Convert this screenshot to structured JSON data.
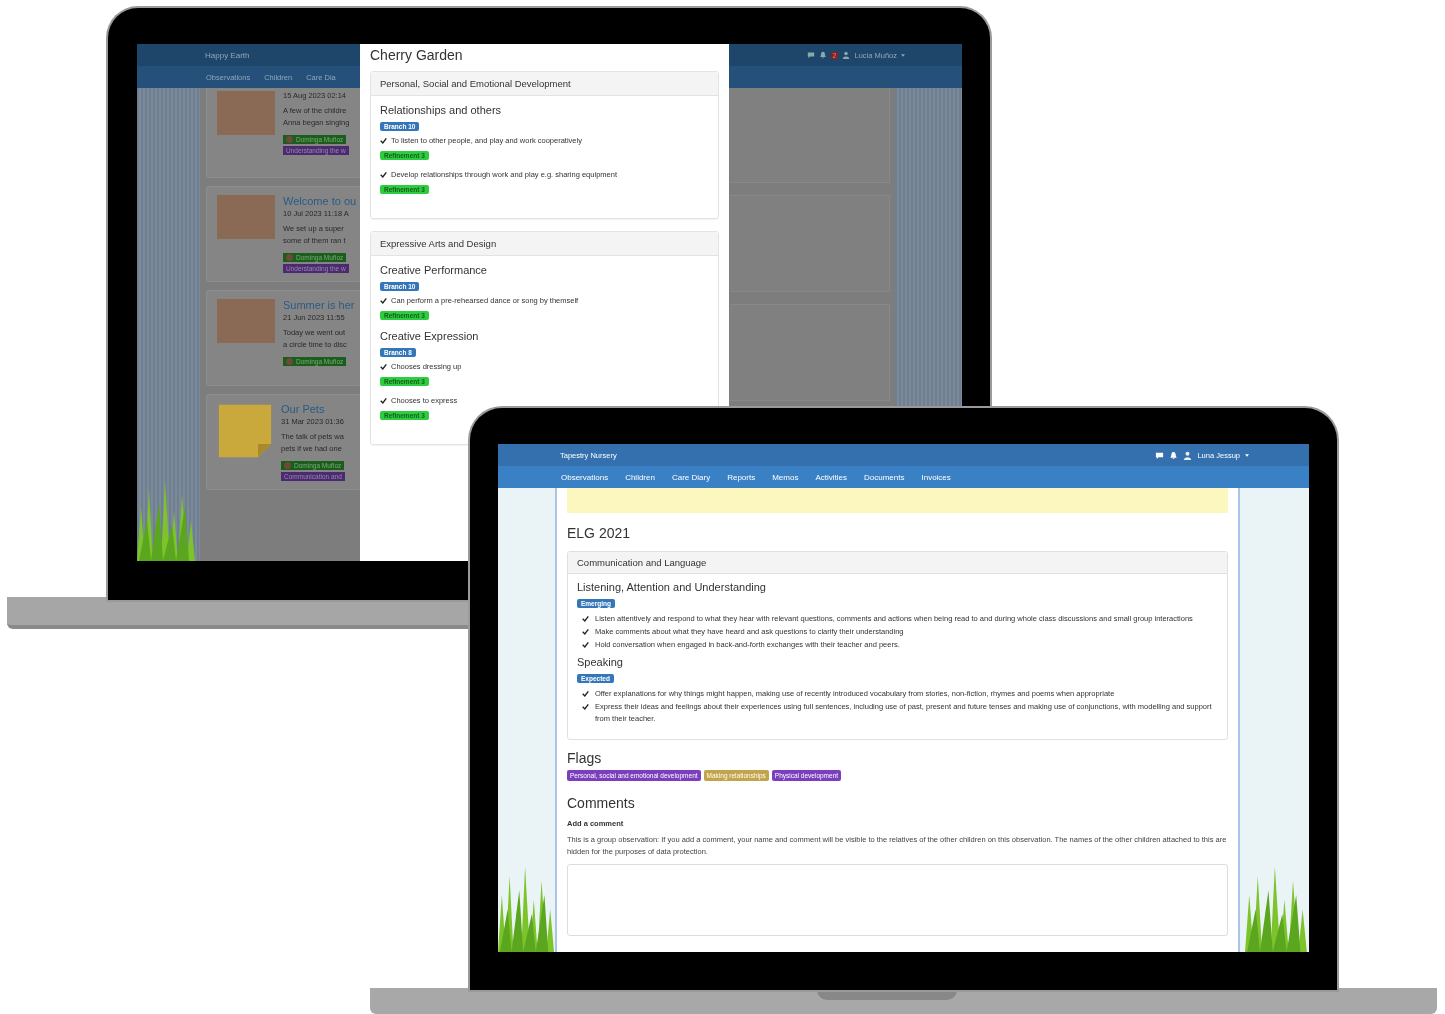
{
  "back_screen": {
    "header": {
      "brand": "Happy Earth",
      "nav": [
        "Observations",
        "Children",
        "Care Dia"
      ],
      "notification_count": "2",
      "user": "Lucia Muñoz"
    },
    "feed": [
      {
        "kind": "photo",
        "date": "15 Aug 2023 02:14",
        "text": [
          "A few of the childre",
          "Anna began singing"
        ],
        "person": "Dominga Muñoz",
        "tag": "Understanding the w"
      },
      {
        "kind": "photo",
        "title": "Welcome to ou",
        "date": "10 Jul 2023 11:18 A",
        "text": [
          "We set up a super",
          "some of them ran t"
        ],
        "person": "Dominga Muñoz",
        "tag": "Understanding the w"
      },
      {
        "kind": "photo",
        "title": "Summer is her",
        "date": "21 Jun 2023 11:55",
        "text": [
          "Today we went out",
          "a circle time to disc"
        ],
        "person": "Dominga Muñoz"
      },
      {
        "kind": "note",
        "title": "Our Pets",
        "date": "31 Mar 2023 01:36",
        "text": [
          "The talk of pets wa",
          "pets if we had one"
        ],
        "person": "Dominga Muñoz",
        "tag": "Communication and"
      }
    ],
    "modal": {
      "title": "Cherry Garden",
      "panels": [
        {
          "title": "Personal, Social and Emotional Development",
          "sections": [
            {
              "title": "Relationships and others",
              "branch": "Branch 10",
              "statements": [
                {
                  "text": "To listen to other people, and play and work cooperatively",
                  "refinement": "Refinement 3"
                },
                {
                  "text": "Develop relationships through work and play e.g. sharing equipment",
                  "refinement": "Refinement 3"
                }
              ]
            }
          ]
        },
        {
          "title": "Expressive Arts and Design",
          "sections": [
            {
              "title": "Creative Performance",
              "branch": "Branch 10",
              "statements": [
                {
                  "text": "Can perform a pre-rehearsed dance or song by themself",
                  "refinement": "Refinement 3"
                }
              ]
            },
            {
              "title": "Creative Expression",
              "branch": "Branch 8",
              "statements": [
                {
                  "text": "Chooses dressing up",
                  "refinement": "Refinement 3"
                },
                {
                  "text": "Chooses to express",
                  "refinement": "Refinement 3"
                }
              ]
            }
          ]
        }
      ]
    }
  },
  "front_screen": {
    "header": {
      "brand": "Tapestry Nursery",
      "user": "Luna Jessup",
      "nav": [
        "Observations",
        "Children",
        "Care Diary",
        "Reports",
        "Memos",
        "Activities",
        "Documents",
        "Invoices"
      ]
    },
    "heading": "ELG 2021",
    "panel": {
      "title": "Communication and Language",
      "sections": [
        {
          "title": "Listening, Attention and Understanding",
          "badge": "Emerging",
          "statements": [
            "Listen attentively and respond to what they hear with relevant questions, comments and actions when being read to and during whole class discussions and small group interactions",
            "Make comments about what they have heard and ask questions to clarify their understanding",
            "Hold conversation when engaged in back-and-forth exchanges with their teacher and peers."
          ]
        },
        {
          "title": "Speaking",
          "badge": "Expected",
          "statements": [
            "Offer explanations for why things might happen, making use of recently introduced vocabulary from stories, non-fiction, rhymes and poems when appropriate",
            "Express their ideas and feelings about their experiences using full sentences, including use of past, present and future tenses and making use of conjunctions, with modelling and support from their teacher."
          ]
        }
      ]
    },
    "flags_heading": "Flags",
    "flags": [
      {
        "label": "Personal, social and emotional development",
        "color": "#7b3fbe"
      },
      {
        "label": "Making relationships",
        "color": "#c2a44a"
      },
      {
        "label": "Physical development",
        "color": "#7b3fbe"
      }
    ],
    "comments_heading": "Comments",
    "comment_label": "Add a comment",
    "comment_note": "This is a group observation: If you add a comment, your name and comment will be visible to the relatives of the other children on this observation. The names of the other children attached to this are hidden for the purposes of data protection."
  }
}
